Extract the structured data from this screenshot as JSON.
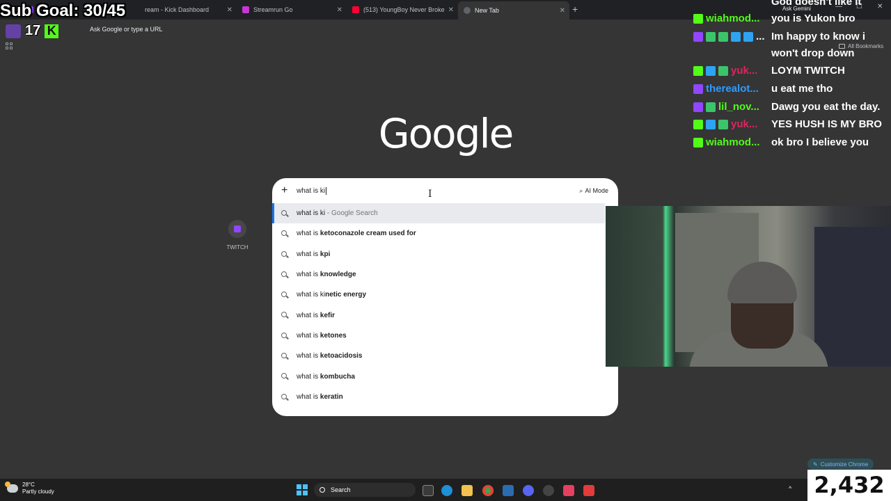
{
  "tabs": [
    {
      "label": "",
      "active": false
    },
    {
      "label": "ream - Kick Dashboard",
      "active": false
    },
    {
      "label": "Streamrun Go",
      "active": false
    },
    {
      "label": "(513) YoungBoy Never Broke",
      "active": false
    },
    {
      "label": "New Tab",
      "active": true
    }
  ],
  "window_controls": {
    "minimize": "—",
    "maximize": "☐",
    "close": "✕"
  },
  "omnibox": {
    "placeholder": "Ask Google or type a URL"
  },
  "bookmarks_bar": {
    "all_bookmarks": "All Bookmarks"
  },
  "overlay": {
    "sub_goal": "Sub Goal: 30/45",
    "counter": "17",
    "viewer_count": "2,432"
  },
  "google": {
    "logo": "Google",
    "query": "what is ki",
    "ai_mode": "AI Mode",
    "suggestions": [
      {
        "prefix": "what is ki",
        "bold": "",
        "suffix": " - Google Search",
        "highlighted": true
      },
      {
        "prefix": "what is ",
        "bold": "ketoconazole cream used for",
        "suffix": ""
      },
      {
        "prefix": "what is ",
        "bold": "kpi",
        "suffix": ""
      },
      {
        "prefix": "what is ",
        "bold": "knowledge",
        "suffix": ""
      },
      {
        "prefix": "what is ki",
        "bold": "netic energy",
        "suffix": ""
      },
      {
        "prefix": "what is ",
        "bold": "kefir",
        "suffix": ""
      },
      {
        "prefix": "what is ",
        "bold": "ketones",
        "suffix": ""
      },
      {
        "prefix": "what is ",
        "bold": "ketoacidosis",
        "suffix": ""
      },
      {
        "prefix": "what is ",
        "bold": "kombucha",
        "suffix": ""
      },
      {
        "prefix": "what is ",
        "bold": "keratin",
        "suffix": ""
      }
    ],
    "shortcut": {
      "label": "TWITCH"
    },
    "customize": "Customize Chrome"
  },
  "chat": {
    "top_partial": "God doesn't like it",
    "ask_gemini": "Ask Gemini",
    "messages": [
      {
        "user": "wiahmod...",
        "color": "#53fc18",
        "text": "you is Yukon bro"
      },
      {
        "user": "...",
        "color": "#ffffff",
        "text": "Im happy to know i"
      },
      {
        "user": "",
        "color": "#ffffff",
        "text": "won't drop down"
      },
      {
        "user": "yuk...",
        "color": "#e0245e",
        "text": "LOYM TWITCH"
      },
      {
        "user": "therealot...",
        "color": "#2e9bff",
        "text": "u eat me tho"
      },
      {
        "user": "lil_nov...",
        "color": "#53fc18",
        "text": "Dawg you eat the day."
      },
      {
        "user": "yuk...",
        "color": "#e0245e",
        "text": "YES HUSH IS MY BRO"
      },
      {
        "user": "wiahmod...",
        "color": "#53fc18",
        "text": "ok bro I believe you"
      }
    ]
  },
  "taskbar": {
    "weather_temp": "28°C",
    "weather_desc": "Partly cloudy",
    "search": "Search",
    "tray_arrow": "^"
  }
}
